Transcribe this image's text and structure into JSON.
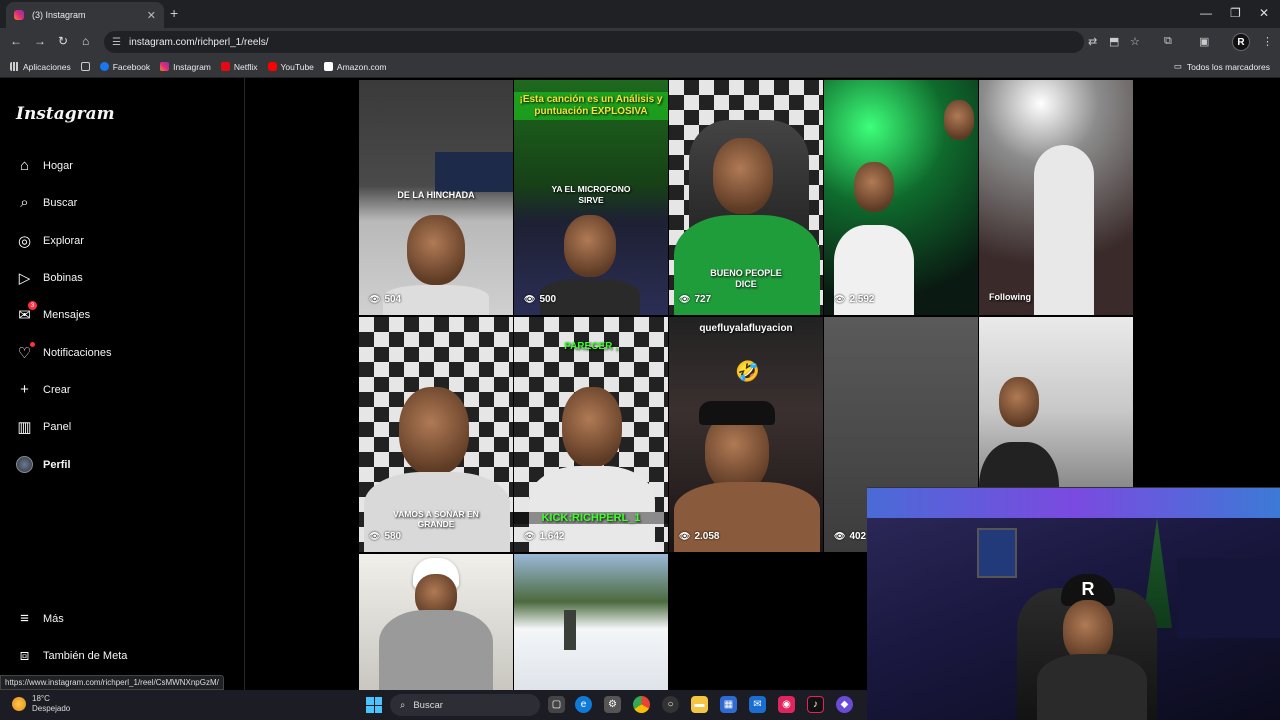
{
  "browser": {
    "tab_title": "(3) Instagram",
    "url": "instagram.com/richperl_1/reels/",
    "bookmarks": [
      "Aplicaciones",
      "Facebook",
      "Instagram",
      "Netflix",
      "YouTube",
      "Amazon.com"
    ],
    "all_bookmarks": "Todos los marcadores",
    "status_url": "https://www.instagram.com/richperl_1/reel/CsMWNXnpGzM/"
  },
  "sidebar": {
    "logo": "Instagram",
    "items": [
      {
        "label": "Hogar",
        "icon": "home-icon"
      },
      {
        "label": "Buscar",
        "icon": "search-icon"
      },
      {
        "label": "Explorar",
        "icon": "compass-icon"
      },
      {
        "label": "Bobinas",
        "icon": "reels-icon"
      },
      {
        "label": "Mensajes",
        "icon": "messenger-icon",
        "badge": "3"
      },
      {
        "label": "Notificaciones",
        "icon": "heart-icon"
      },
      {
        "label": "Crear",
        "icon": "plus-icon"
      },
      {
        "label": "Panel",
        "icon": "chart-icon"
      },
      {
        "label": "Perfil",
        "icon": "avatar"
      }
    ],
    "more": "Más",
    "meta": "También de Meta"
  },
  "reels": [
    {
      "views": "504",
      "caption": "DE LA HINCHADA"
    },
    {
      "views": "500",
      "caption": "¡Esta canción es un Análisis y puntuación EXPLOSIVA",
      "caption2": "YA EL MICROFONO SIRVE"
    },
    {
      "views": "727",
      "caption": "BUENO PEOPLE DICE"
    },
    {
      "views": "2.592",
      "caption": ""
    },
    {
      "views": "",
      "caption": "Following"
    },
    {
      "views": "580",
      "caption": "VAMOS A SOÑAR EN GRANDE"
    },
    {
      "views": "1.642",
      "caption": "PARECER ,",
      "caption2": "KICK:RICHPERL_1"
    },
    {
      "views": "2.058",
      "caption": "quefluyalafluyacion"
    },
    {
      "views": "402",
      "caption": ""
    },
    {
      "views": "",
      "caption": ""
    },
    {
      "views": "",
      "caption": ""
    },
    {
      "views": "",
      "caption": ""
    }
  ],
  "taskbar": {
    "temp": "18°C",
    "weather": "Despejado",
    "search": "Buscar"
  },
  "colors": {
    "accent_red": "#ff3040",
    "bg": "#000000"
  }
}
